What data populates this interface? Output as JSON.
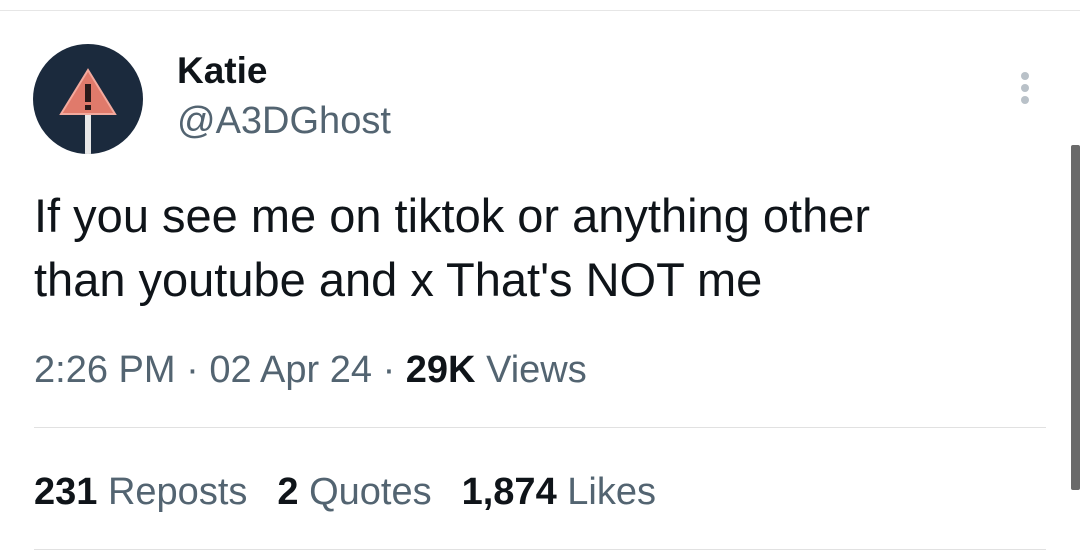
{
  "author": {
    "display_name": "Katie",
    "handle": "@A3DGhost",
    "avatar_icon": "warning-sign-icon"
  },
  "tweet": {
    "text_line1": "If you see me on tiktok or anything other",
    "text_line2": "than youtube and x That's NOT me",
    "time": "2:26 PM",
    "separator": "·",
    "date": "02 Apr 24",
    "views_count": "29K",
    "views_label": "Views"
  },
  "stats": {
    "reposts_count": "231",
    "reposts_label": "Reposts",
    "quotes_count": "2",
    "quotes_label": "Quotes",
    "likes_count": "1,874",
    "likes_label": "Likes"
  },
  "colors": {
    "text_primary": "#0f1419",
    "text_secondary": "#536471",
    "avatar_bg": "#1b2a3d",
    "warning_triangle": "#e07a6b"
  }
}
